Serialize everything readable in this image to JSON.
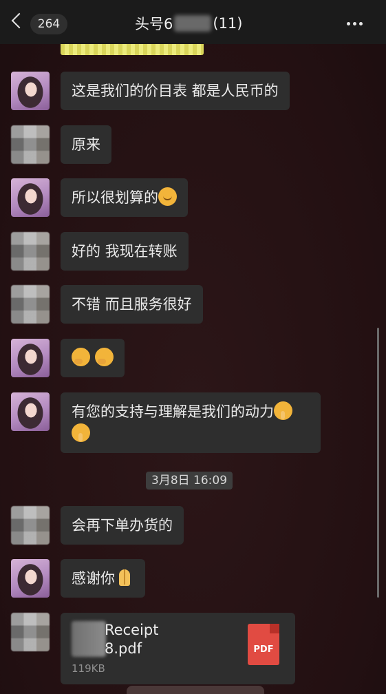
{
  "header": {
    "unread_count": "264",
    "title_prefix": "头号6",
    "title_suffix": "(11)"
  },
  "messages": [
    {
      "text": "这是我们的价目表 都是人民币的"
    },
    {
      "text": "原来"
    },
    {
      "text": "所以很划算的"
    },
    {
      "text": "好的 我现在转账"
    },
    {
      "text": "不错 而且服务很好"
    },
    {
      "text": "有您的支持与理解是我们的动力"
    },
    {
      "text": "会再下单办货的"
    },
    {
      "text": "感谢你"
    }
  ],
  "timestamp": "3月8日 16:09",
  "file": {
    "name_line1": "Receipt",
    "name_line2": "8.pdf",
    "size": "119KB",
    "type_label": "PDF"
  },
  "icons": [
    "back-chevron-icon",
    "more-icon",
    "smile-emoji-icon",
    "thinking-emoji-icon",
    "shushing-emoji-icon",
    "pray-emoji-icon",
    "pdf-file-icon"
  ]
}
